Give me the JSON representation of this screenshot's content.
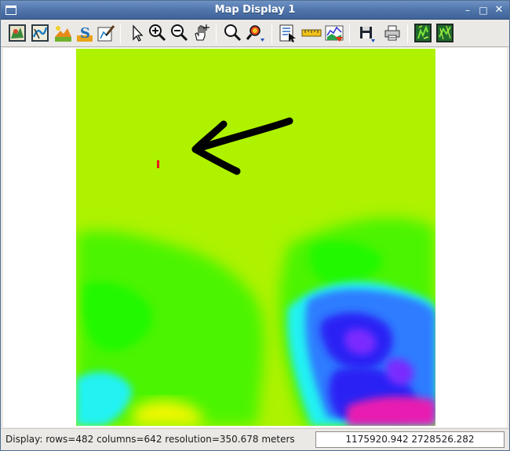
{
  "window": {
    "title": "Map Display 1",
    "controls": [
      "minimize",
      "maximize",
      "close"
    ],
    "control_glyphs": {
      "minimize": "–",
      "maximize": "□",
      "close": "✕"
    }
  },
  "toolbar": {
    "groups": [
      [
        "add-raster-map-icon",
        "add-vector-map-icon",
        "add-overlay-icon",
        "add-text-icon",
        "draw-icon"
      ],
      [
        "pointer-icon",
        "zoom-in-icon",
        "zoom-out-icon",
        "pan-icon"
      ],
      [
        "zoom-to-map-icon",
        "zoom-options-icon"
      ],
      [
        "query-icon",
        "measure-icon",
        "profile-icon"
      ],
      [
        "save-icon",
        "print-icon"
      ],
      [
        "decoration-icon",
        "map-extent-icon"
      ]
    ]
  },
  "map": {
    "palette": {
      "background": "#aef200",
      "green": "#4cf400",
      "bright_green": "#22f800",
      "cyan": "#22f2f2",
      "blue": "#2e7cff",
      "deep_blue": "#2a20f4",
      "purple": "#7a2cff",
      "magenta": "#e81ab0",
      "yellow": "#f2f800",
      "marker": "#e8191c",
      "arrow": "#000000"
    }
  },
  "status": {
    "display_info": "Display: rows=482 columns=642  resolution=350.678 meters",
    "coordinates": "1175920.942 2728526.282"
  }
}
